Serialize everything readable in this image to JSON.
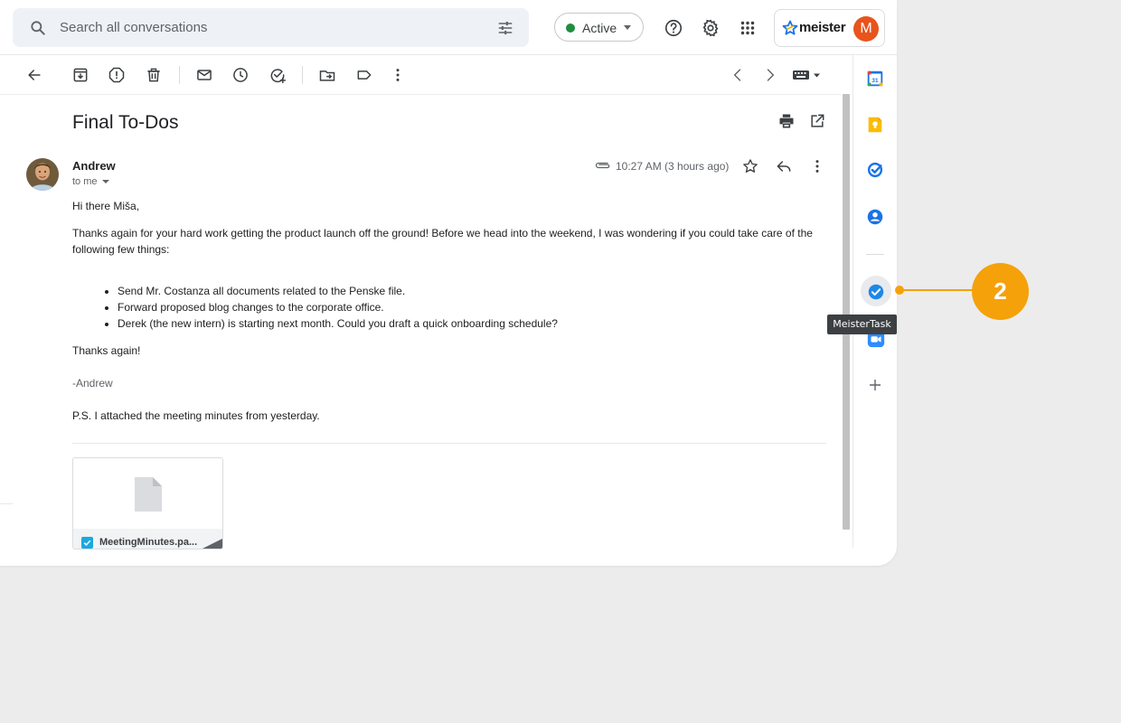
{
  "search": {
    "placeholder": "Search all conversations"
  },
  "status": {
    "label": "Active",
    "color": "#1e8e3e"
  },
  "brand": {
    "name": "meister",
    "avatar_letter": "M",
    "avatar_color": "#e8541d"
  },
  "email": {
    "subject": "Final To-Dos",
    "sender": "Andrew",
    "recipient": "to me",
    "time": "10:27 AM (3 hours ago)",
    "greeting": "Hi there Miša,",
    "paragraph": "Thanks again for your hard work getting the product launch off the ground! Before we head into the weekend, I was wondering if you could take care of the following few things:",
    "items": [
      "Send Mr. Costanza all documents related to the Penske file.",
      "Forward proposed blog changes to the corporate office.",
      "Derek (the new intern) is starting next month. Could you draft a quick onboarding schedule?"
    ],
    "thanks": "Thanks again!",
    "signature": "-Andrew",
    "ps": "P.S. I attached the meeting minutes from yesterday.",
    "attachment_name": "MeetingMinutes.pa..."
  },
  "sidepanel": {
    "tooltip": "MeisterTask"
  },
  "callout": {
    "number": "2",
    "color": "#f5a10a"
  }
}
